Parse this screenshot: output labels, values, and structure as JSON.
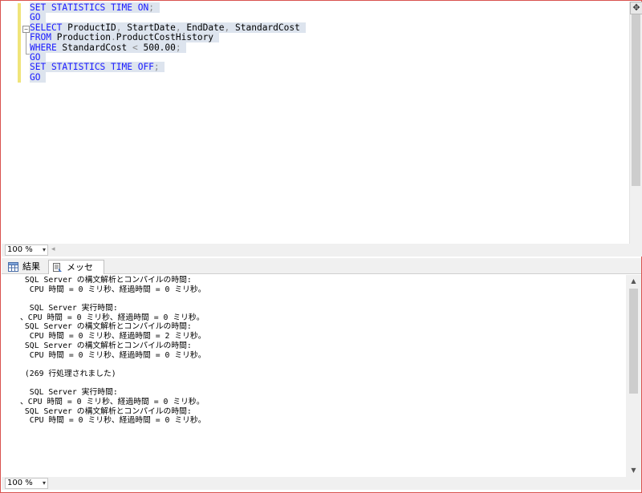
{
  "editor": {
    "lines": [
      [
        {
          "t": "SET STATISTICS TIME ON",
          "c": "kw"
        },
        {
          "t": ";",
          "c": "op"
        }
      ],
      [
        {
          "t": "GO",
          "c": "kw"
        }
      ],
      [
        {
          "t": "SELECT",
          "c": "kw"
        },
        {
          "t": " ProductID",
          "c": "plain"
        },
        {
          "t": ",",
          "c": "op"
        },
        {
          "t": " StartDate",
          "c": "plain"
        },
        {
          "t": ",",
          "c": "op"
        },
        {
          "t": " EndDate",
          "c": "plain"
        },
        {
          "t": ",",
          "c": "op"
        },
        {
          "t": " StandardCost",
          "c": "plain"
        }
      ],
      [
        {
          "t": "FROM",
          "c": "kw"
        },
        {
          "t": " Production",
          "c": "plain"
        },
        {
          "t": ".",
          "c": "op"
        },
        {
          "t": "ProductCostHistory",
          "c": "plain"
        }
      ],
      [
        {
          "t": "WHERE",
          "c": "kw"
        },
        {
          "t": " StandardCost ",
          "c": "plain"
        },
        {
          "t": "<",
          "c": "op"
        },
        {
          "t": " 500.00",
          "c": "num"
        },
        {
          "t": ";",
          "c": "op"
        }
      ],
      [
        {
          "t": "GO",
          "c": "kw"
        }
      ],
      [
        {
          "t": "SET STATISTICS TIME OFF",
          "c": "kw"
        },
        {
          "t": ";",
          "c": "op"
        }
      ],
      [
        {
          "t": "GO",
          "c": "kw"
        }
      ]
    ],
    "split_icon": "✥"
  },
  "zoom": {
    "editor_value": "100 %",
    "messages_value": "100 %",
    "caret_icon": "▾",
    "left_arrow_icon": "◂"
  },
  "tabs": {
    "results_label": "結果",
    "messages_label": "メッセージ"
  },
  "messages": {
    "lines": [
      " SQL Server の構文解析とコンパイルの時間: ",
      "  CPU 時間 = 0 ミリ秒、経過時間 = 0 ミリ秒。",
      "",
      "  SQL Server 実行時間:",
      "、CPU 時間 = 0 ミリ秒、経過時間 = 0 ミリ秒。",
      " SQL Server の構文解析とコンパイルの時間: ",
      "  CPU 時間 = 0 ミリ秒、経過時間 = 2 ミリ秒。",
      " SQL Server の構文解析とコンパイルの時間: ",
      "  CPU 時間 = 0 ミリ秒、経過時間 = 0 ミリ秒。",
      "",
      " (269 行処理されました)",
      "",
      "  SQL Server 実行時間:",
      "、CPU 時間 = 0 ミリ秒、経過時間 = 0 ミリ秒。",
      " SQL Server の構文解析とコンパイルの時間: ",
      "  CPU 時間 = 0 ミリ秒、経過時間 = 0 ミリ秒。"
    ],
    "scroll_up_icon": "▲",
    "scroll_down_icon": "▼"
  },
  "colors": {
    "keyword": "#1a1aff",
    "selection": "#dde4ee",
    "change_marker": "#f0e47a",
    "frame_border": "#d9534f"
  }
}
